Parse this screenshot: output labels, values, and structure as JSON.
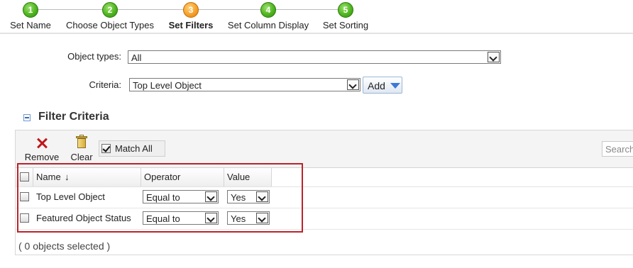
{
  "wizard": {
    "steps": [
      {
        "number": "1",
        "label": "Set Name",
        "state": "done"
      },
      {
        "number": "2",
        "label": "Choose Object Types",
        "state": "done"
      },
      {
        "number": "3",
        "label": "Set Filters",
        "state": "active"
      },
      {
        "number": "4",
        "label": "Set Column Display",
        "state": "todo"
      },
      {
        "number": "5",
        "label": "Set Sorting",
        "state": "todo"
      }
    ]
  },
  "form": {
    "object_types_label": "Object types:",
    "object_types_value": "All",
    "criteria_label": "Criteria:",
    "criteria_value": "Top Level Object",
    "add_button": "Add"
  },
  "filter_criteria": {
    "title": "Filter Criteria",
    "toolbar": {
      "remove_label": "Remove",
      "clear_label": "Clear",
      "match_all_label": "Match All",
      "match_all_checked": true,
      "search_placeholder": "Search"
    },
    "columns": {
      "name": "Name",
      "sort_indicator": "↓",
      "operator": "Operator",
      "value": "Value"
    },
    "rows": [
      {
        "name": "Top Level Object",
        "operator": "Equal to",
        "value": "Yes"
      },
      {
        "name": "Featured Object Status",
        "operator": "Equal to",
        "value": "Yes"
      }
    ],
    "footer": "( 0 objects selected )"
  },
  "colors": {
    "step_done": "#4fb51f",
    "step_active": "#f7a12a",
    "highlight_border": "#b8242c",
    "remove_icon": "#c0161b"
  }
}
